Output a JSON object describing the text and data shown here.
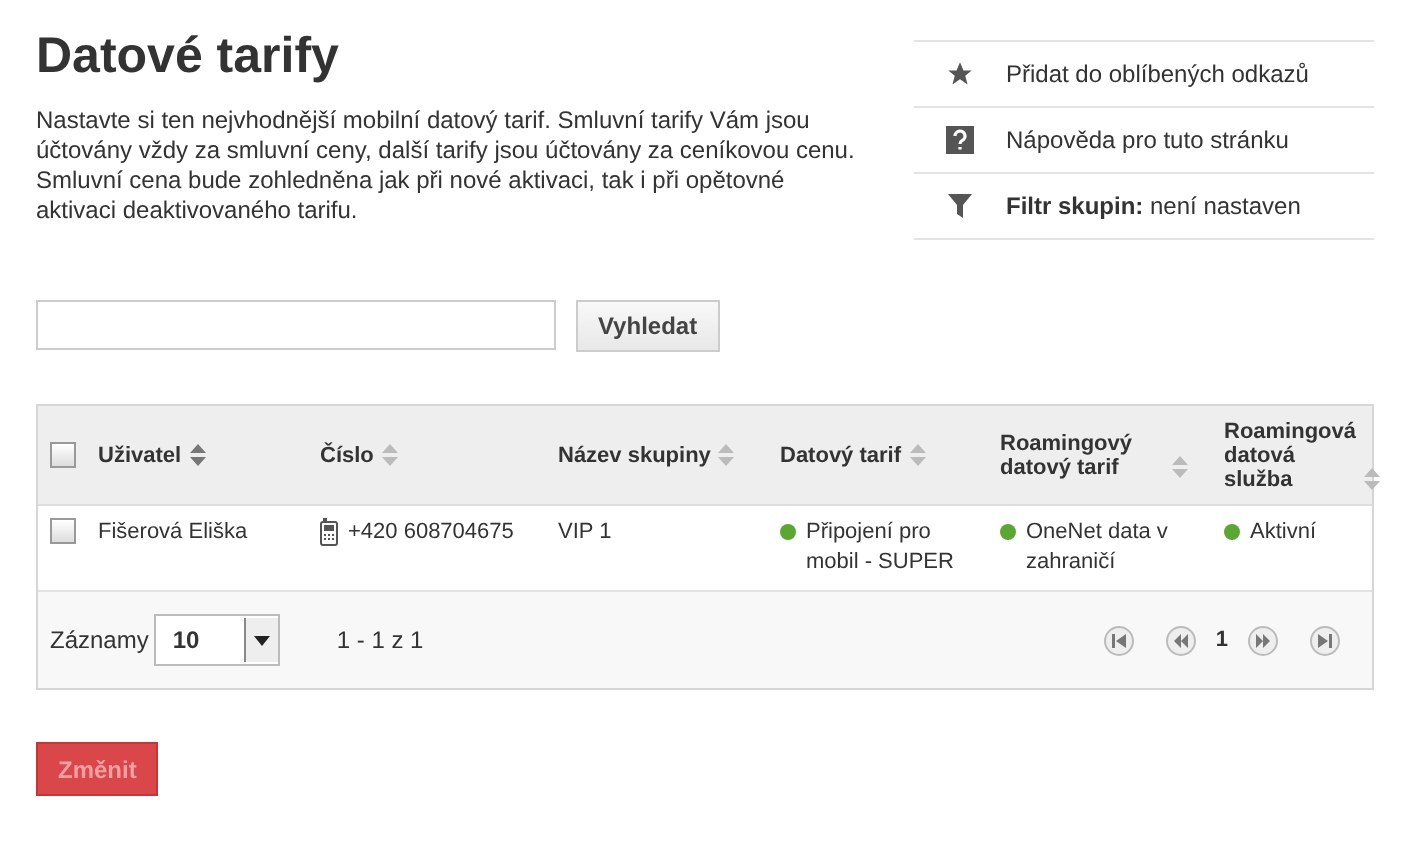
{
  "title": "Datové tarify",
  "description": "Nastavte si ten nejvhodnější mobilní datový tarif. Smluvní tarify Vám jsou účtovány vždy za smluvní ceny, další tarify jsou účtovány za ceníkovou cenu. Smluvní cena bude zohledněna jak při nové aktivaci, tak i při opětovné aktivaci deaktivovaného tarifu.",
  "side_links": [
    {
      "kind": "star",
      "text": "Přidat do oblíbených odkazů"
    },
    {
      "kind": "help",
      "text": "Nápověda pro tuto stránku"
    },
    {
      "kind": "filter",
      "text": "**Filtr skupin:** není nastaven"
    }
  ],
  "search": {
    "button": "Vyhledat"
  },
  "table": {
    "select_all_checked": false,
    "columns": [
      {
        "label": "Uživatel",
        "sorted": true
      },
      {
        "label": "Číslo",
        "sorted": false
      },
      {
        "label": "Název skupiny",
        "sorted": false
      },
      {
        "label": "Datový tarif",
        "sorted": false
      },
      {
        "label": "Roamingový datový tarif",
        "sorted": false
      },
      {
        "label": "Roamingová datová služba",
        "sorted": false
      }
    ],
    "rows": [
      {
        "checked": false,
        "user": "Fišerová Eliška",
        "number": "+420 608704675",
        "group": "VIP 1",
        "statuses": [
          {
            "text": "Připojení pro mobil - SUPER",
            "color": "#5aa832"
          },
          {
            "text": "OneNet data v zahraničí",
            "color": "#5aa832"
          },
          {
            "text": "Aktivní",
            "color": "#5aa832"
          }
        ]
      }
    ]
  },
  "pager": {
    "records_label": "Záznamy",
    "page_size": "10",
    "range": "1 - 1 z 1",
    "current_page": "1"
  },
  "submit": {
    "label": "Změnit",
    "disabled": true
  }
}
